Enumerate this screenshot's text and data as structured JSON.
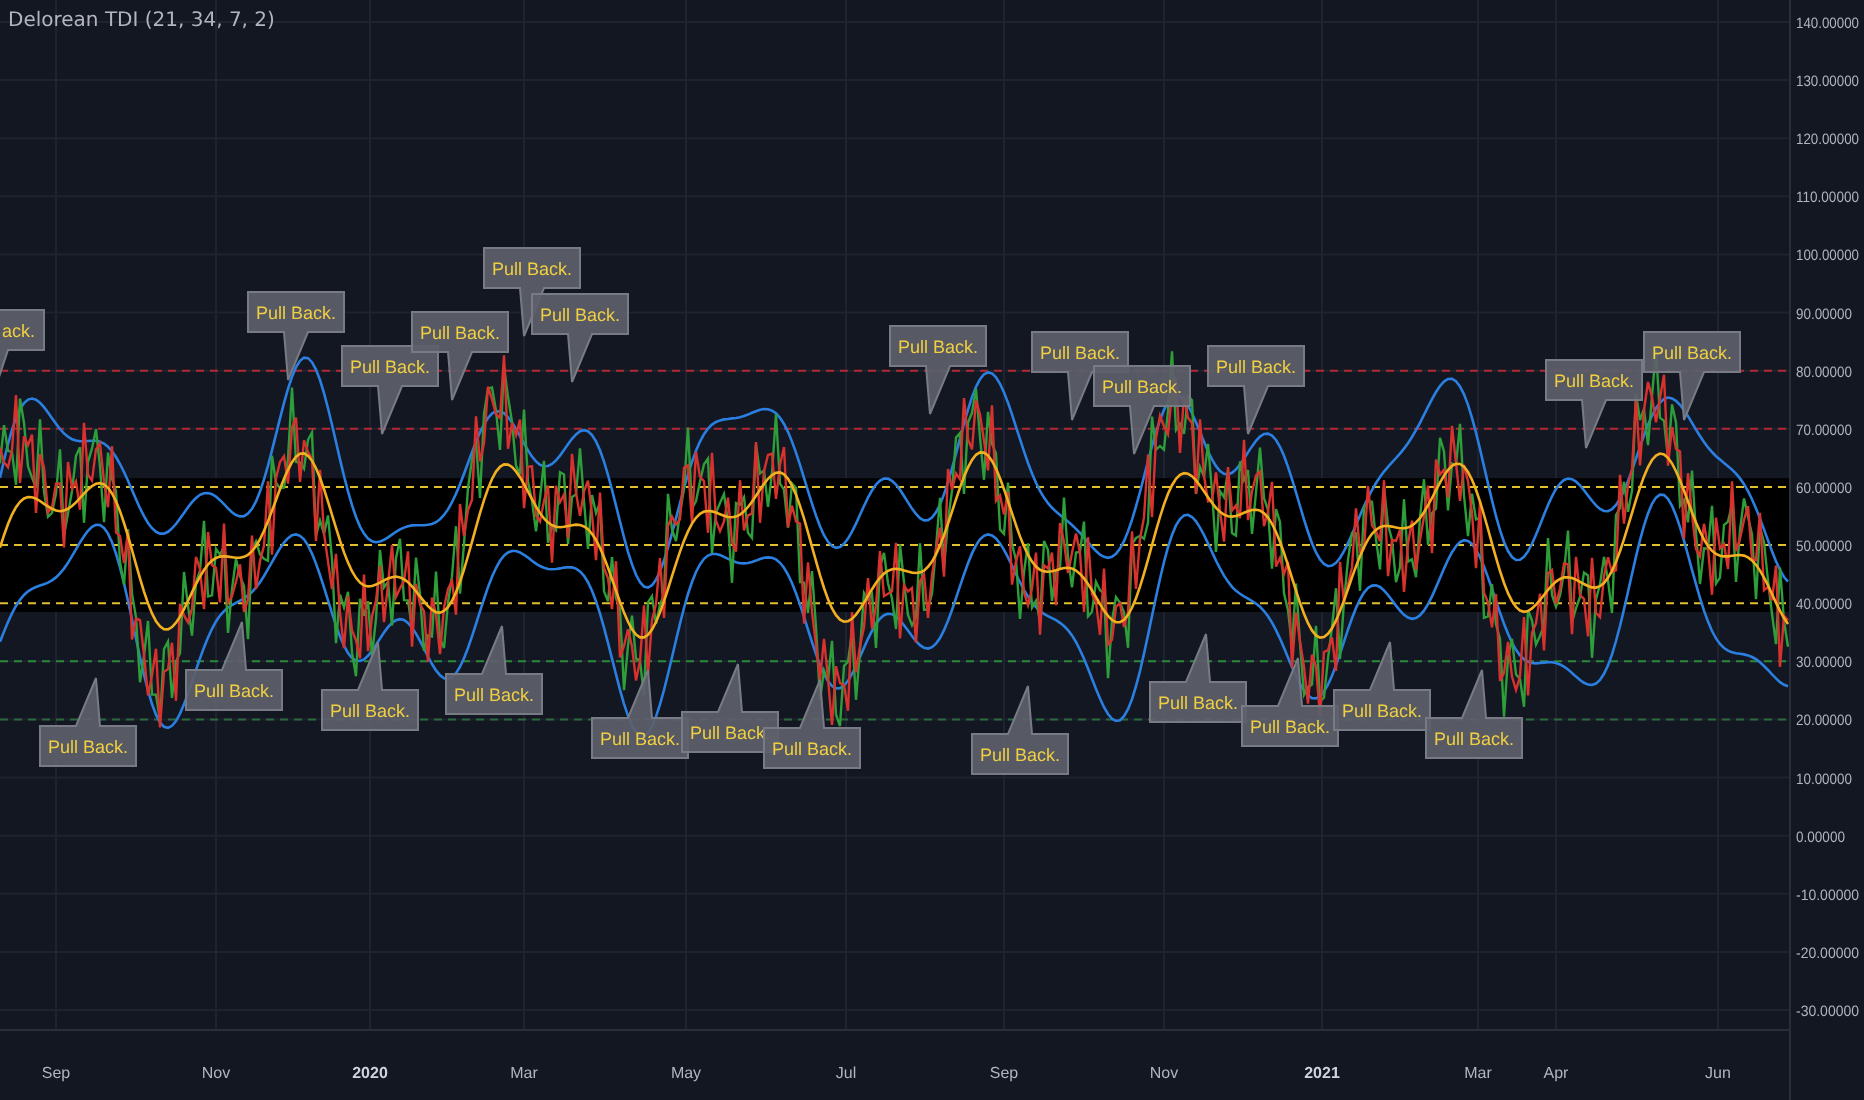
{
  "indicator": {
    "title": "Delorean TDI (21, 34, 7, 2)"
  },
  "y_axis": [
    "140.00000",
    "130.00000",
    "120.00000",
    "110.00000",
    "100.00000",
    "90.00000",
    "80.00000",
    "70.00000",
    "60.00000",
    "50.00000",
    "40.00000",
    "30.00000",
    "20.00000",
    "10.00000",
    "0.00000",
    "-10.00000",
    "-20.00000",
    "-30.00000"
  ],
  "x_axis": [
    {
      "label": "Sep",
      "bold": false
    },
    {
      "label": "Nov",
      "bold": false
    },
    {
      "label": "2020",
      "bold": true
    },
    {
      "label": "Mar",
      "bold": false
    },
    {
      "label": "May",
      "bold": false
    },
    {
      "label": "Jul",
      "bold": false
    },
    {
      "label": "Sep",
      "bold": false
    },
    {
      "label": "Nov",
      "bold": false
    },
    {
      "label": "2021",
      "bold": true
    },
    {
      "label": "Mar",
      "bold": false
    },
    {
      "label": "Apr",
      "bold": false
    },
    {
      "label": "Jun",
      "bold": false
    }
  ],
  "callouts": [
    {
      "text": "ack.",
      "kind": "above"
    },
    {
      "text": "Pull Back.",
      "kind": "above"
    },
    {
      "text": "Pull Back.",
      "kind": "above"
    },
    {
      "text": "Pull Back.",
      "kind": "above"
    },
    {
      "text": "Pull Back.",
      "kind": "above"
    },
    {
      "text": "Pull Back.",
      "kind": "above"
    },
    {
      "text": "Pull Back.",
      "kind": "above"
    },
    {
      "text": "Pull Back.",
      "kind": "above"
    },
    {
      "text": "Pull Back.",
      "kind": "above"
    },
    {
      "text": "Pull Back.",
      "kind": "above"
    },
    {
      "text": "Pull Back.",
      "kind": "above"
    },
    {
      "text": "Pull Back.",
      "kind": "above"
    },
    {
      "text": "Pull Back.",
      "kind": "below"
    },
    {
      "text": "Pull Back.",
      "kind": "below"
    },
    {
      "text": "Pull Back.",
      "kind": "below"
    },
    {
      "text": "Pull Back.",
      "kind": "below"
    },
    {
      "text": "Pull Back.",
      "kind": "below"
    },
    {
      "text": "Pull Back.",
      "kind": "below"
    },
    {
      "text": "Pull Back.",
      "kind": "below"
    },
    {
      "text": "Pull Back.",
      "kind": "below"
    },
    {
      "text": "Pull Back.",
      "kind": "below"
    },
    {
      "text": "Pull Back.",
      "kind": "below"
    },
    {
      "text": "Pull Back.",
      "kind": "below"
    },
    {
      "text": "Pull Back.",
      "kind": "below"
    }
  ]
}
